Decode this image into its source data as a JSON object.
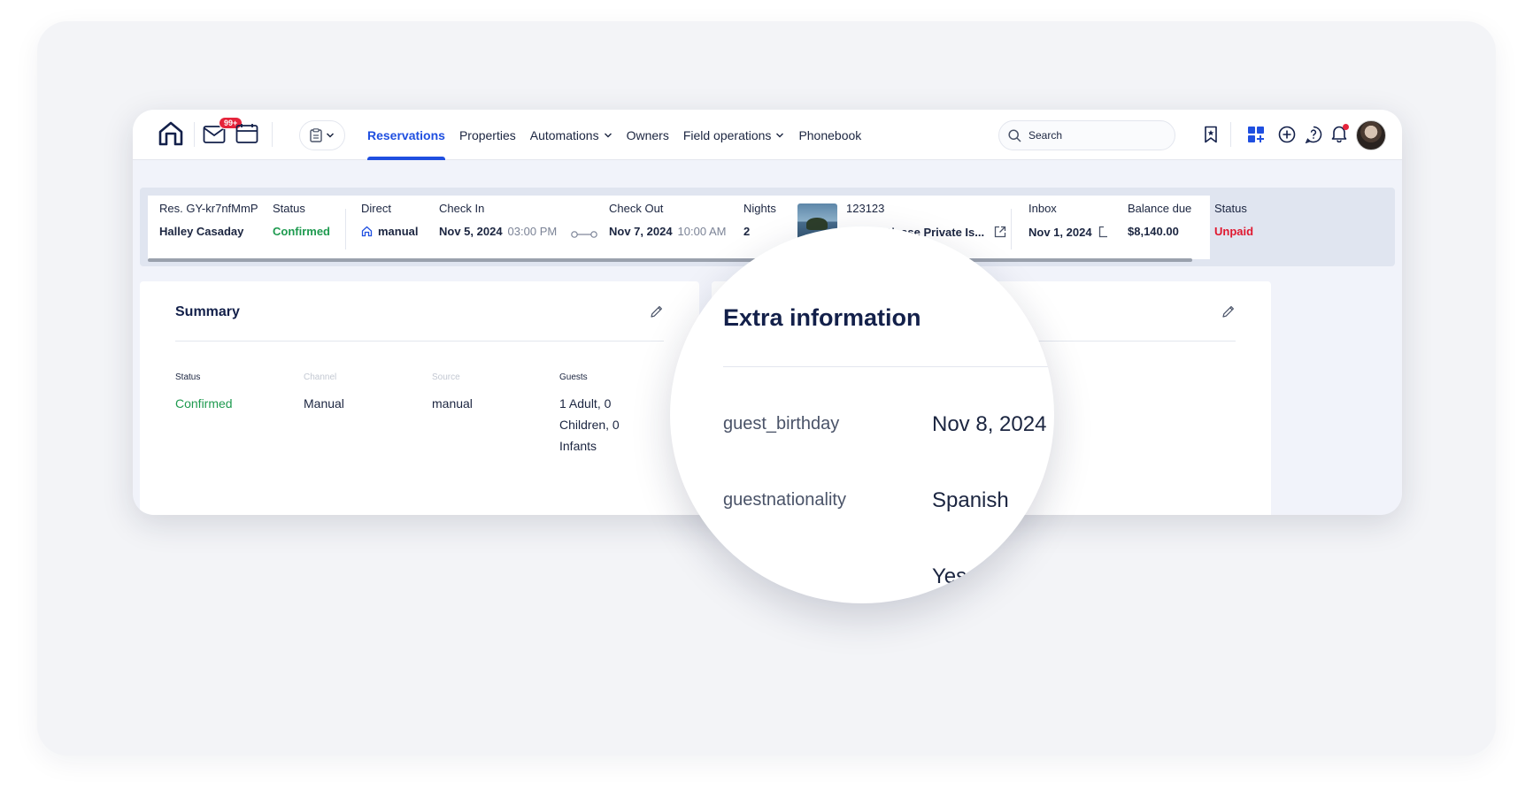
{
  "nav": {
    "badge": "99+",
    "links": [
      {
        "label": "Reservations",
        "active": true,
        "dropdown": false
      },
      {
        "label": "Properties",
        "active": false,
        "dropdown": false
      },
      {
        "label": "Automations",
        "active": false,
        "dropdown": true
      },
      {
        "label": "Owners",
        "active": false,
        "dropdown": false
      },
      {
        "label": "Field operations",
        "active": false,
        "dropdown": true
      },
      {
        "label": "Phonebook",
        "active": false,
        "dropdown": false
      }
    ],
    "search_placeholder": "Search",
    "icons": [
      "home-icon",
      "inbox-icon",
      "calendar-icon",
      "clipboard-icon",
      "search-icon",
      "bookmark-icon",
      "apps-icon",
      "plus-circle-icon",
      "help-icon",
      "bell-icon"
    ],
    "accent_color": "#1f4fe0"
  },
  "reservation": {
    "res_id": "Res. GY-kr7nfMmP",
    "guest_name": "Halley Casaday",
    "status_label": "Status",
    "status": "Confirmed",
    "channel_label": "Direct",
    "channel": "manual",
    "checkin_label": "Check In",
    "checkin_date": "Nov 5, 2024",
    "checkin_time": "03:00 PM",
    "checkout_label": "Check Out",
    "checkout_date": "Nov 7, 2024",
    "checkout_time": "10:00 AM",
    "nights_label": "Nights",
    "nights": "2",
    "listing_id": "123123",
    "listing_name": "Beach Please Private Is...",
    "inbox_label": "Inbox",
    "inbox_date": "Nov 1, 2024",
    "balance_label": "Balance due",
    "balance": "$8,140.00",
    "payment_status_label": "Status",
    "payment_status": "Unpaid",
    "status_colors": {
      "confirmed": "#1e9a4f",
      "unpaid": "#e0182f"
    }
  },
  "summary": {
    "title": "Summary",
    "fields": [
      {
        "label": "Status",
        "value": "Confirmed"
      },
      {
        "label": "Channel",
        "value": "Manual"
      },
      {
        "label": "Source",
        "value": "manual"
      },
      {
        "label": "Guests",
        "value": "1 Adult, 0 Children, 0 Infants"
      }
    ],
    "guests_lines": [
      "1 Adult, 0",
      "Children, 0",
      "Infants"
    ]
  },
  "extra": {
    "title": "Extra information",
    "rows": [
      {
        "key": "guest_birthday",
        "value": "Nov 8, 2024"
      },
      {
        "key": "guestnationality",
        "value": "Spanish"
      },
      {
        "key": "",
        "value": "Yes"
      }
    ]
  }
}
